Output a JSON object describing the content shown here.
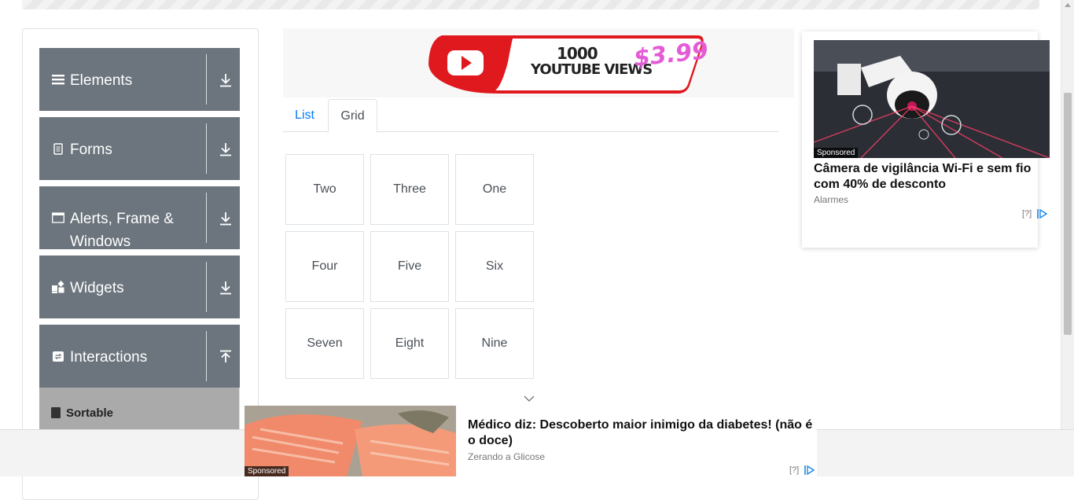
{
  "sidebar": {
    "groups": [
      {
        "label": "Elements",
        "icon": "list-icon",
        "arrow": "download-arrow-icon"
      },
      {
        "label": "Forms",
        "icon": "form-icon",
        "arrow": "download-arrow-icon"
      },
      {
        "label": "Alerts, Frame & Windows",
        "icon": "window-icon",
        "arrow": "download-arrow-icon"
      },
      {
        "label": "Widgets",
        "icon": "widgets-icon",
        "arrow": "download-arrow-icon"
      },
      {
        "label": "Interactions",
        "icon": "interactions-icon",
        "arrow": "upload-arrow-icon"
      }
    ],
    "active_item": "Sortable"
  },
  "banner_ad": {
    "line1": "1000",
    "line2": "YOUTUBE VIEWS",
    "price": "$3.99"
  },
  "tabs": [
    {
      "label": "List",
      "active": false
    },
    {
      "label": "Grid",
      "active": true
    }
  ],
  "grid_items": [
    "Two",
    "Three",
    "One",
    "Four",
    "Five",
    "Six",
    "Seven",
    "Eight",
    "Nine"
  ],
  "right_ad": {
    "sponsored": "Sponsored",
    "headline": "Câmera de vigilância Wi-Fi e sem fio com 40% de desconto",
    "source": "Alarmes",
    "info": "[?]"
  },
  "bottom_ad": {
    "sponsored": "Sponsored",
    "headline": "Médico diz: Descoberto maior inimigo da diabetes! (não é o doce)",
    "source": "Zerando a Glicose",
    "info": "[?]"
  },
  "colors": {
    "menu_bg": "#6c757d",
    "active_item_bg": "#aaaaaa",
    "tab_active_text": "#495057",
    "tab_link": "#007bff",
    "youtube_red": "#e0191f",
    "price_pink": "#e45bd6"
  }
}
